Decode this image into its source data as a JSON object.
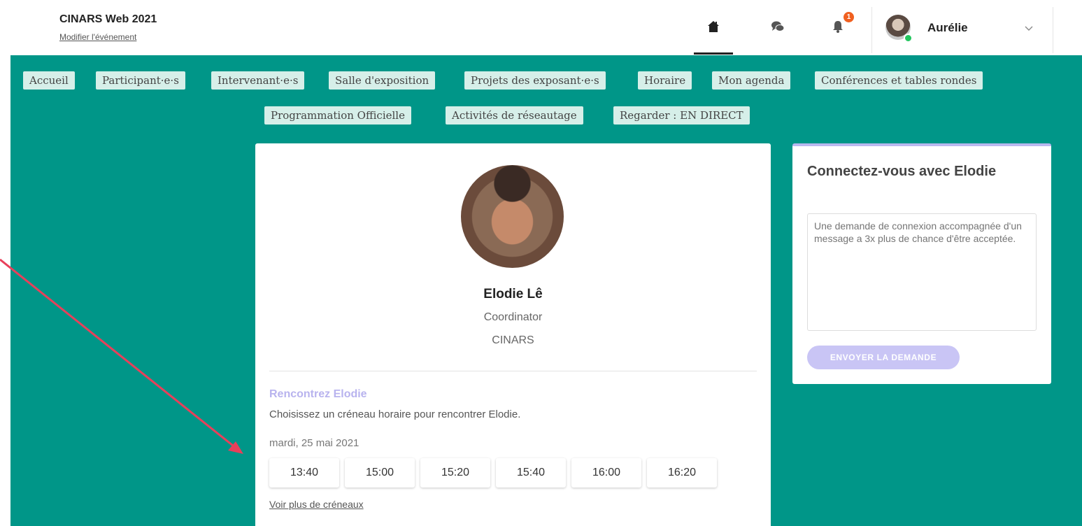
{
  "header": {
    "event_title": "CINARS Web 2021",
    "edit_event": "Modifier l'événement",
    "notification_count": "1",
    "user_name": "Aurélie"
  },
  "icons": {
    "home": "home-icon",
    "chat": "chat-icon",
    "bell": "bell-icon",
    "chevron": "chevron-down-icon"
  },
  "menu": [
    "Accueil",
    "Participant·e·s",
    "Intervenant·e·s",
    "Salle d'exposition",
    "Projets des exposant·e·s",
    "Horaire",
    "Mon agenda",
    "Conférences et tables rondes",
    "Programmation Officielle",
    "Activités de réseautage",
    "Regarder : EN DIRECT"
  ],
  "profile": {
    "name": "Elodie Lê",
    "role": "Coordinator",
    "organization": "CINARS"
  },
  "meeting": {
    "title": "Rencontrez Elodie",
    "description": "Choisissez un créneau horaire pour rencontrer Elodie.",
    "date": "mardi, 25 mai 2021",
    "slots": [
      "13:40",
      "15:00",
      "15:20",
      "15:40",
      "16:00",
      "16:20"
    ],
    "more_slots": "Voir plus de créneaux"
  },
  "connect": {
    "title": "Connectez-vous avec Elodie",
    "placeholder": "Une demande de connexion accompagnée d'un message a 3x plus de chance d'être acceptée.",
    "button": "ENVOYER LA DEMANDE"
  },
  "colors": {
    "teal": "#009688",
    "menu_bg": "#d6efe9",
    "accent_lavender": "#b9b8ef",
    "button_lavender": "#c9c5f5",
    "online": "#22c55e",
    "badge": "#f06020",
    "annotation_arrow": "#e8405a"
  }
}
